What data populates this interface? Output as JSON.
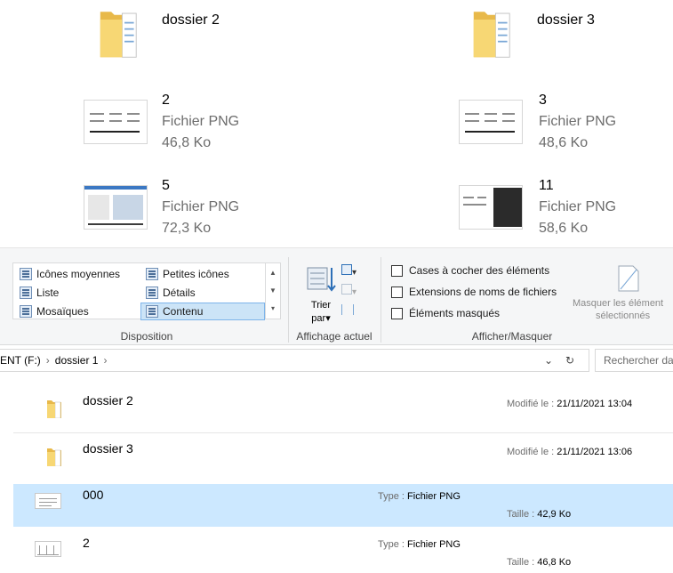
{
  "tiles": [
    {
      "name": "dossier 2",
      "kind": "folder"
    },
    {
      "name": "dossier 3",
      "kind": "folder"
    },
    {
      "name": "2",
      "type": "Fichier PNG",
      "size": "46,8 Ko"
    },
    {
      "name": "3",
      "type": "Fichier PNG",
      "size": "48,6 Ko"
    },
    {
      "name": "5",
      "type": "Fichier PNG",
      "size": "72,3 Ko"
    },
    {
      "name": "11",
      "type": "Fichier PNG",
      "size": "58,6 Ko"
    }
  ],
  "ribbon": {
    "layout": {
      "items": [
        "Icônes moyennes",
        "Petites icônes",
        "Liste",
        "Détails",
        "Mosaïques",
        "Contenu"
      ],
      "selected": "Contenu",
      "label": "Disposition"
    },
    "current_view": {
      "sort_label_1": "Trier",
      "sort_label_2": "par",
      "label": "Affichage actuel"
    },
    "show_hide": {
      "checkboxes": [
        "Cases à cocher des éléments",
        "Extensions de noms de fichiers",
        "Éléments masqués"
      ],
      "hide_selected_1": "Masquer les élément",
      "hide_selected_2": "sélectionnés",
      "label": "Afficher/Masquer"
    }
  },
  "address": {
    "crumb_root": "ENT (F:)",
    "crumb_folder": "dossier 1",
    "search_placeholder": "Rechercher da"
  },
  "list": [
    {
      "name": "dossier 2",
      "meta_label": "Modifié le :",
      "meta_value": "21/11/2021 13:04"
    },
    {
      "name": "dossier 3",
      "meta_label": "Modifié le :",
      "meta_value": "21/11/2021 13:06"
    },
    {
      "name": "000",
      "type_label": "Type :",
      "type_value": "Fichier PNG",
      "size_label": "Taille :",
      "size_value": "42,9 Ko",
      "selected": true
    },
    {
      "name": "2",
      "type_label": "Type :",
      "type_value": "Fichier PNG",
      "size_label": "Taille :",
      "size_value": "46,8 Ko"
    }
  ],
  "colors": {
    "selection": "#cce8ff",
    "folder": "#f7d774",
    "folder_dark": "#e8b94a",
    "secondary_text": "#6d6d6d"
  }
}
